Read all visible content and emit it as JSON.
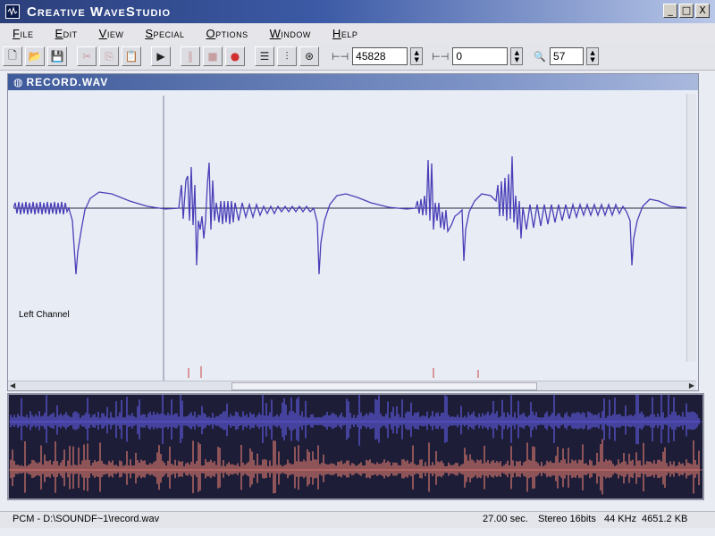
{
  "window": {
    "title": "Creative WaveStudio"
  },
  "window_controls": {
    "minimize": "_",
    "maximize": "□",
    "close": "X"
  },
  "menu": [
    "File",
    "Edit",
    "View",
    "Special",
    "Options",
    "Window",
    "Help"
  ],
  "toolbar": {
    "buttons": [
      {
        "name": "new-file-icon",
        "glyph": "🗋"
      },
      {
        "name": "open-folder-icon",
        "glyph": "📂"
      },
      {
        "name": "save-icon",
        "glyph": "💾"
      },
      {
        "name": "cut-icon",
        "glyph": "✂"
      },
      {
        "name": "copy-icon",
        "glyph": "⎘"
      },
      {
        "name": "paste-icon",
        "glyph": "📋"
      },
      {
        "name": "play-icon",
        "glyph": "▶"
      },
      {
        "name": "pause-icon",
        "glyph": "‖"
      },
      {
        "name": "stop-icon",
        "glyph": "■"
      },
      {
        "name": "record-icon",
        "glyph": "●"
      },
      {
        "name": "list-icon",
        "glyph": "☰"
      },
      {
        "name": "mixer-icon",
        "glyph": "⫶"
      },
      {
        "name": "settings-icon",
        "glyph": "⊛"
      }
    ],
    "start_value": "45828",
    "length_value": "0",
    "zoom_value": "57"
  },
  "document": {
    "title": "RECORD.WAV",
    "channel_label": "Left Channel"
  },
  "status": {
    "file": "PCM - D:\\SOUNDF~1\\record.wav",
    "duration": "27.00 sec.",
    "format": "Stereo 16bits",
    "rate": "44 KHz",
    "size": "4651.2 KB"
  },
  "colors": {
    "waveform": "#4a3fb8",
    "overview_left": "#6b66ff",
    "overview_right": "#ff8a78",
    "overview_bg": "#1d1d38"
  }
}
